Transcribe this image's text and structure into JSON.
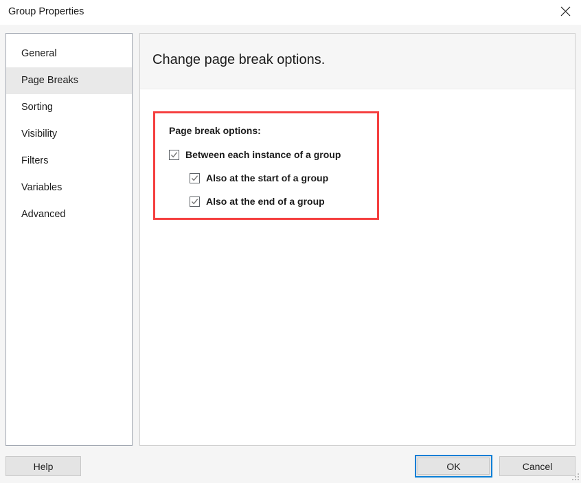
{
  "window": {
    "title": "Group Properties",
    "close_icon": "close-icon"
  },
  "sidebar": {
    "items": [
      {
        "label": "General",
        "selected": false
      },
      {
        "label": "Page Breaks",
        "selected": true
      },
      {
        "label": "Sorting",
        "selected": false
      },
      {
        "label": "Visibility",
        "selected": false
      },
      {
        "label": "Filters",
        "selected": false
      },
      {
        "label": "Variables",
        "selected": false
      },
      {
        "label": "Advanced",
        "selected": false
      }
    ]
  },
  "content": {
    "header": "Change page break options.",
    "options_label": "Page break options:",
    "checkboxes": [
      {
        "label": "Between each instance of a group",
        "checked": true
      },
      {
        "label": "Also at the start of a group",
        "checked": true
      },
      {
        "label": "Also at the end of a group",
        "checked": true
      }
    ]
  },
  "footer": {
    "help_label": "Help",
    "ok_label": "OK",
    "cancel_label": "Cancel"
  },
  "colors": {
    "highlight_red": "#f53f3f",
    "focus_blue": "#0a7fd6",
    "selected_row": "#e9e9e9"
  }
}
